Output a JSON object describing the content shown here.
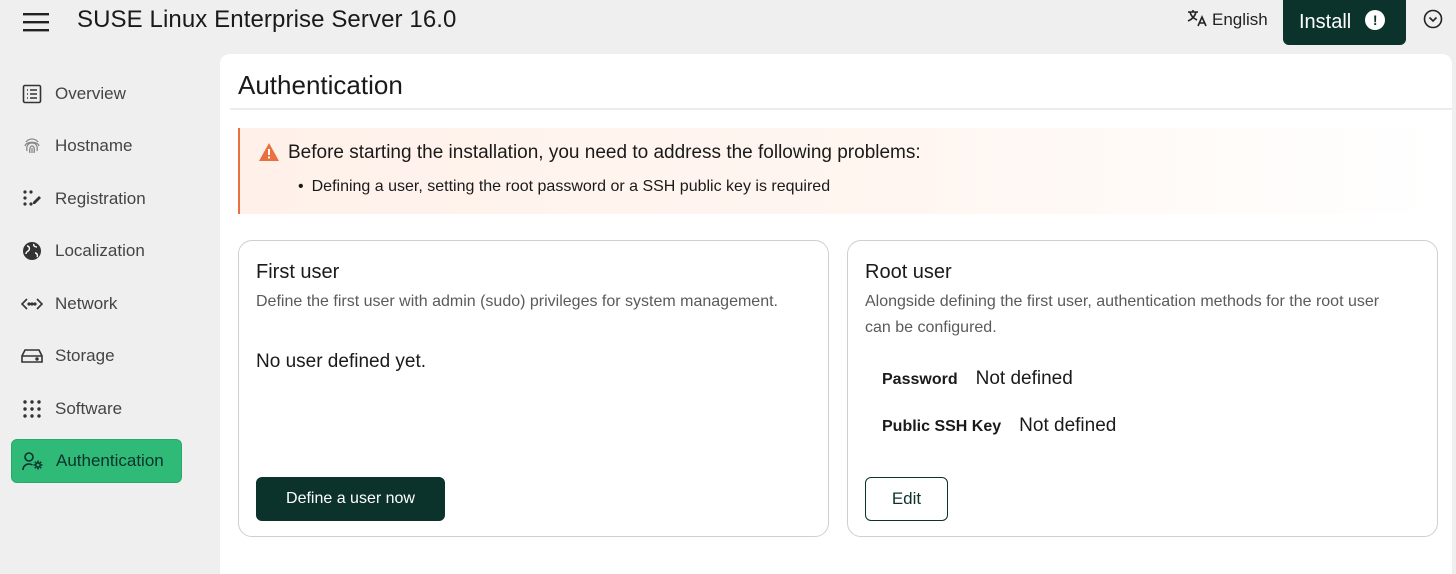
{
  "header": {
    "title": "SUSE Linux Enterprise Server 16.0",
    "language": "English",
    "install_label": "Install"
  },
  "sidebar": {
    "items": [
      {
        "label": "Overview",
        "icon": "list-icon"
      },
      {
        "label": "Hostname",
        "icon": "fingerprint-icon"
      },
      {
        "label": "Registration",
        "icon": "dots-edit-icon"
      },
      {
        "label": "Localization",
        "icon": "globe-icon"
      },
      {
        "label": "Network",
        "icon": "code-arrows-icon"
      },
      {
        "label": "Storage",
        "icon": "drive-icon"
      },
      {
        "label": "Software",
        "icon": "grid-dots-icon"
      },
      {
        "label": "Authentication",
        "icon": "user-gear-icon",
        "active": true
      }
    ]
  },
  "page": {
    "title": "Authentication"
  },
  "alert": {
    "title": "Before starting the installation, you need to address the following problems:",
    "items": [
      "Defining a user, setting the root password or a SSH public key is required"
    ]
  },
  "first_user": {
    "title": "First user",
    "description": "Define the first user with admin (sudo) privileges for system management.",
    "status": "No user defined yet.",
    "button": "Define a user now"
  },
  "root_user": {
    "title": "Root user",
    "description": "Alongside defining the first user, authentication methods for the root user can be configured.",
    "password_label": "Password",
    "password_value": "Not defined",
    "ssh_label": "Public SSH Key",
    "ssh_value": "Not defined",
    "button": "Edit"
  },
  "colors": {
    "primary": "#0c322c",
    "accent": "#30ba78",
    "warning": "#e9713f"
  }
}
